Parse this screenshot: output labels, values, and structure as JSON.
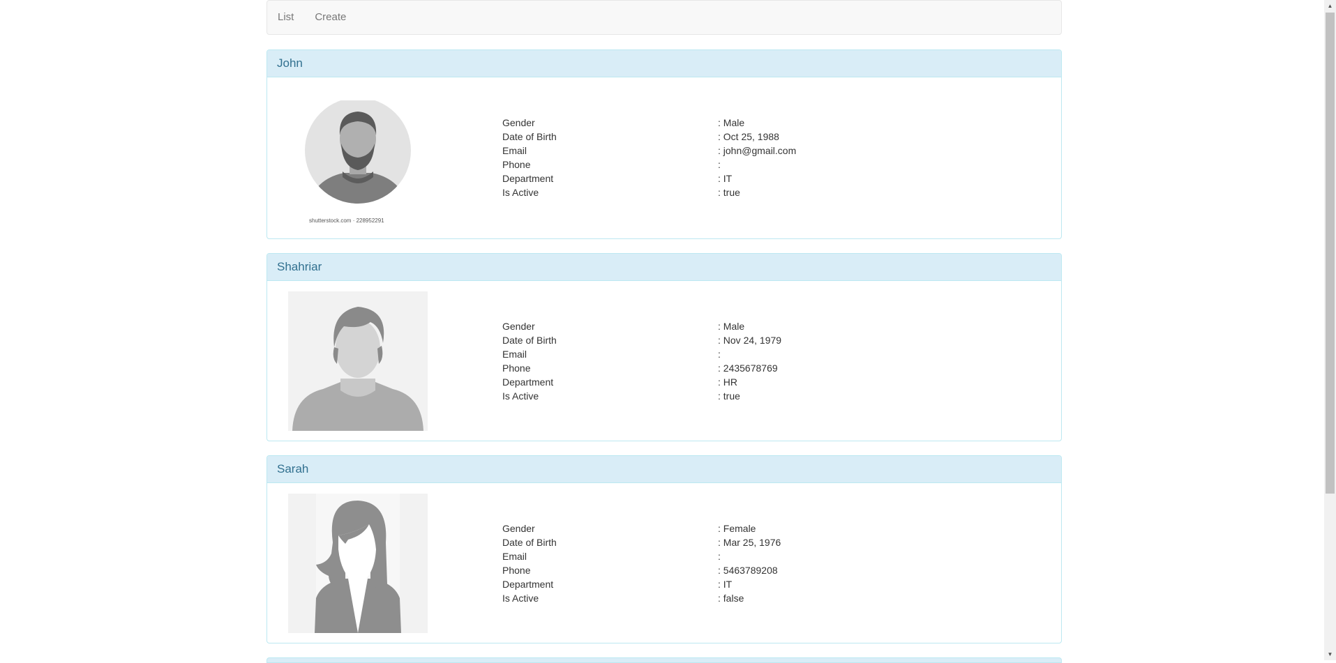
{
  "nav": {
    "list_label": "List",
    "create_label": "Create"
  },
  "labels": {
    "gender": "Gender",
    "dob": "Date of Birth",
    "email": "Email",
    "phone": "Phone",
    "department": "Department",
    "is_active": "Is Active"
  },
  "employees": [
    {
      "name": "John",
      "photo_credit": "shutterstock.com · 228952291",
      "gender": ": Male",
      "dob": ": Oct 25, 1988",
      "email": ": john@gmail.com",
      "phone": ":",
      "department": ": IT",
      "is_active": ": true"
    },
    {
      "name": "Shahriar",
      "gender": ": Male",
      "dob": ": Nov 24, 1979",
      "email": ":",
      "phone": ": 2435678769",
      "department": ": HR",
      "is_active": ": true"
    },
    {
      "name": "Sarah",
      "gender": ": Female",
      "dob": ": Mar 25, 1976",
      "email": ":",
      "phone": ": 5463789208",
      "department": ": IT",
      "is_active": ": false"
    }
  ],
  "icons": {
    "scroll_up": "up-arrow-icon",
    "scroll_down": "down-arrow-icon"
  }
}
